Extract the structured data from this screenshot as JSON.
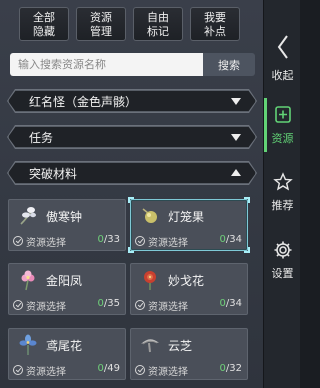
{
  "top_buttons": [
    {
      "label": "全部\n隐藏"
    },
    {
      "label": "资源\n管理"
    },
    {
      "label": "自由\n标记"
    },
    {
      "label": "我要\n补点"
    }
  ],
  "search": {
    "placeholder": "输入搜索资源名称",
    "button_label": "搜索"
  },
  "dropdowns": [
    {
      "label": "红名怪（金色声骸）",
      "state": "collapsed"
    },
    {
      "label": "任务",
      "state": "collapsed"
    },
    {
      "label": "突破材料",
      "state": "expanded"
    }
  ],
  "cards": [
    {
      "name": "傲寒钟",
      "select_label": "资源选择",
      "have": "0",
      "total": "/33",
      "icon": "flower-icon",
      "selected": false
    },
    {
      "name": "灯笼果",
      "select_label": "资源选择",
      "have": "0",
      "total": "/34",
      "icon": "lantern-fruit-icon",
      "selected": true
    },
    {
      "name": "金阳凤",
      "select_label": "资源选择",
      "have": "0",
      "total": "/35",
      "icon": "pink-flower-icon",
      "selected": false
    },
    {
      "name": "妙戈花",
      "select_label": "资源选择",
      "have": "0",
      "total": "/34",
      "icon": "red-flower-icon",
      "selected": false
    },
    {
      "name": "鸢尾花",
      "select_label": "资源选择",
      "have": "0",
      "total": "/49",
      "icon": "iris-icon",
      "selected": false
    },
    {
      "name": "云芝",
      "select_label": "资源选择",
      "have": "0",
      "total": "/32",
      "icon": "mushroom-icon",
      "selected": false
    }
  ],
  "sidebar": {
    "collapse_label": "收起",
    "items": [
      {
        "label": "资源",
        "icon": "plus-shield-icon",
        "active": true
      },
      {
        "label": "推荐",
        "icon": "star-icon",
        "active": false
      },
      {
        "label": "设置",
        "icon": "gear-icon",
        "active": false
      }
    ]
  },
  "colors": {
    "accent": "#62d376",
    "selected_border": "#7fc9d6",
    "count_have": "#6fd07a"
  }
}
